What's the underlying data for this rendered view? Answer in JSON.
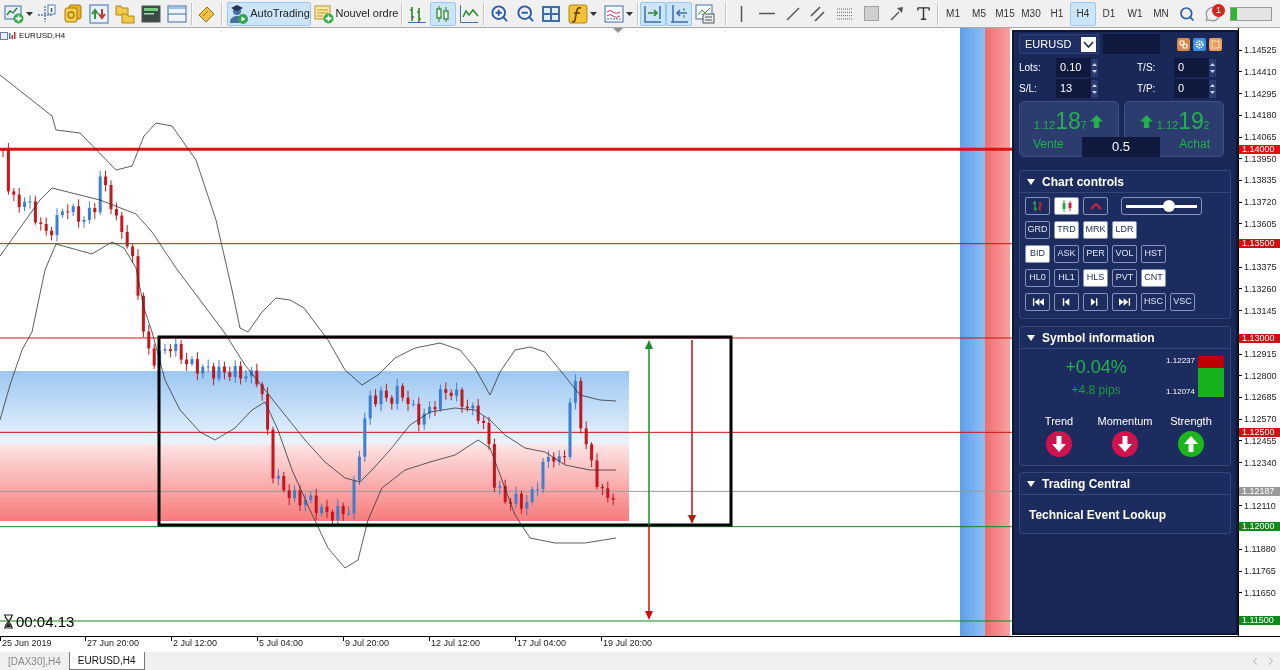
{
  "toolbar": {
    "autotrading": {
      "label": "AutoTrading",
      "on": true
    },
    "new_order": {
      "label": "Nouvel ordre"
    },
    "chart_types": [
      {
        "selected": false
      },
      {
        "selected": true
      },
      {
        "selected": false
      }
    ],
    "chart_options": [
      {
        "selected": true
      },
      {
        "selected": true
      },
      {
        "selected": false
      }
    ],
    "timeframes": [
      {
        "label": "M1",
        "selected": false
      },
      {
        "label": "M5",
        "selected": false
      },
      {
        "label": "M15",
        "selected": false
      },
      {
        "label": "M30",
        "selected": false
      },
      {
        "label": "H1",
        "selected": false
      },
      {
        "label": "H4",
        "selected": true
      },
      {
        "label": "D1",
        "selected": false
      },
      {
        "label": "W1",
        "selected": false
      },
      {
        "label": "MN",
        "selected": false
      }
    ],
    "notifications": {
      "count": "1"
    },
    "status_meter": {
      "level": 0.15
    }
  },
  "chart": {
    "title": "EURUSD,H4",
    "levels": [
      {
        "price": "1.14000",
        "color": "#e01010",
        "kind": "thick"
      },
      {
        "price": "1.13500",
        "color": "#d01010",
        "kind": "thin"
      },
      {
        "price": "1.13000",
        "color": "#d01010",
        "kind": "thin"
      },
      {
        "price": "1.12500",
        "color": "#d01010",
        "kind": "thin"
      },
      {
        "price": "1.12187",
        "color": "#9a9a9a",
        "kind": "thin"
      },
      {
        "price": "1.12000",
        "color": "#0f8a1a",
        "kind": "thin"
      },
      {
        "price": "1.11500",
        "color": "#0f8a1a",
        "kind": "thin"
      }
    ],
    "price_ticks": [
      "1.14525",
      "1.14410",
      "1.14295",
      "1.14180",
      "1.14065",
      "1.13950",
      "1.13835",
      "1.13720",
      "1.13605",
      "1.13375",
      "1.13260",
      "1.13145",
      "1.12915",
      "1.12800",
      "1.12685",
      "1.12570",
      "1.12455",
      "1.12340",
      "1.12110",
      "1.11880",
      "1.11765",
      "1.11650"
    ],
    "time_ticks": [
      "25 Jun 2019",
      "27 Jun 20:00",
      "2 Jul 12:00",
      "5 Jul 04:00",
      "9 Jul 20:00",
      "12 Jul 12:00",
      "17 Jul 04:00",
      "19 Jul 20:00"
    ],
    "timer": "00:04.13"
  },
  "trade_panel": {
    "symbol": "EURUSD",
    "fields": [
      {
        "label": "Lots:",
        "value": "0.10"
      },
      {
        "label": "T/S:",
        "value": "0"
      },
      {
        "label": "S/L:",
        "value": "13"
      },
      {
        "label": "T/P:",
        "value": "0"
      }
    ],
    "sell": {
      "label": "Vente",
      "price_prefix": "1.12",
      "price_main": "18",
      "price_suffix": "7",
      "kind": "up"
    },
    "buy": {
      "label": "Achat",
      "price_prefix": "1.12",
      "price_main": "19",
      "price_suffix": "2",
      "kind": "up"
    },
    "volume": "0.5"
  },
  "chart_controls": {
    "title": "Chart controls",
    "expanded": true,
    "chart_types": [
      {
        "selected": false
      },
      {
        "selected": true
      },
      {
        "selected": false
      }
    ],
    "zoom": {
      "level": 0.6
    },
    "rows": [
      {
        "kind": "toggles",
        "buttons": [
          {
            "label": "GRD",
            "on": false
          },
          {
            "label": "TRD",
            "on": true
          },
          {
            "label": "MRK",
            "on": true
          },
          {
            "label": "LDR",
            "on": true
          }
        ]
      },
      {
        "kind": "toggles",
        "buttons": [
          {
            "label": "BID",
            "on": true
          },
          {
            "label": "ASK",
            "on": false
          },
          {
            "label": "PER",
            "on": false
          },
          {
            "label": "VOL",
            "on": false
          },
          {
            "label": "HST",
            "on": false
          }
        ]
      },
      {
        "kind": "toggles",
        "buttons": [
          {
            "label": "HL0",
            "on": false
          },
          {
            "label": "HL1",
            "on": false
          },
          {
            "label": "HLS",
            "on": true
          },
          {
            "label": "PVT",
            "on": false
          },
          {
            "label": "CNT",
            "on": true
          }
        ]
      },
      {
        "kind": "navigation",
        "buttons": [
          {
            "label": "HSC",
            "on": false
          },
          {
            "label": "VSC",
            "on": false
          }
        ]
      }
    ]
  },
  "symbol_information": {
    "title": "Symbol information",
    "expanded": true,
    "change": "+0.04%",
    "pips": "+4.8 pips",
    "range": {
      "high": "1.12237",
      "low": "1.12074",
      "level": 0.7
    },
    "signals": [
      {
        "label": "Trend",
        "kind": "down"
      },
      {
        "label": "Momentum",
        "kind": "down"
      },
      {
        "label": "Strength",
        "kind": "up"
      }
    ]
  },
  "trading_central": {
    "title": "Trading Central",
    "expanded": true,
    "link": "Technical Event Lookup"
  },
  "tabs": [
    {
      "label": "[DAX30],H4",
      "selected": false
    },
    {
      "label": "EURUSD,H4",
      "selected": true
    }
  ]
}
